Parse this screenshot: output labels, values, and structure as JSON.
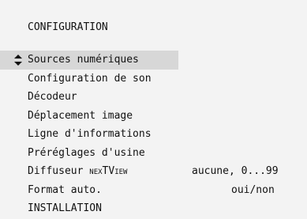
{
  "menu_title": "CONFIGURATION",
  "items": [
    {
      "label": "Sources numériques",
      "value": "",
      "selected": true
    },
    {
      "label": "Configuration de son",
      "value": ""
    },
    {
      "label": "Décodeur",
      "value": ""
    },
    {
      "label": "Déplacement image",
      "value": ""
    },
    {
      "label": "Ligne d'informations",
      "value": ""
    },
    {
      "label": "Préréglages d'usine",
      "value": ""
    },
    {
      "label": "Diffuseur",
      "label_extra_small_1": "NEX",
      "label_extra_big": "TV",
      "label_extra_small_2": "IEW",
      "value": "aucune, 0...99"
    },
    {
      "label": "Format auto.",
      "value": "oui/non"
    },
    {
      "label": "INSTALLATION",
      "value": ""
    }
  ],
  "icons": {
    "selector": "up-down-arrow-icon"
  },
  "colors": {
    "background": "#f3f3f3",
    "highlight": "#d7d7d7",
    "text": "#111111"
  }
}
